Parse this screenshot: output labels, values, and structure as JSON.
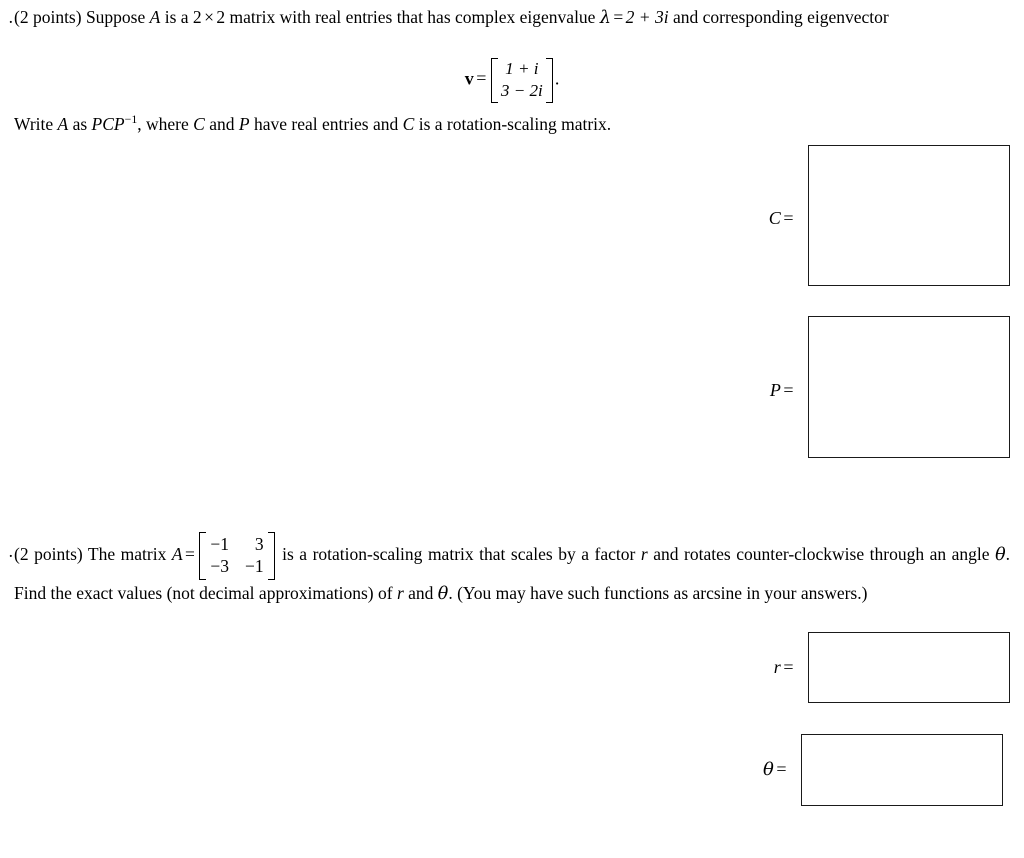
{
  "document": {
    "type": "math-worksheet",
    "page_background": "#ffffff",
    "text_color": "#000000"
  },
  "problems": [
    {
      "marker": ".",
      "points_label": "(2 points)",
      "paragraph_1_pre": "(2 points) Suppose ",
      "var_A": "A",
      "paragraph_1_mid": " is a ",
      "dim_2a": "2",
      "times": "×",
      "dim_2b": "2",
      "paragraph_1_mid2": " matrix with real entries that has complex eigenvalue ",
      "lambda": "λ",
      "equals": "=",
      "eigenvalue": "2 + 3i",
      "paragraph_1_end": " and corresponding eigenvector",
      "vector": {
        "name": "v",
        "equals": "=",
        "entries": [
          "1 + i",
          "3 − 2i"
        ],
        "trailing_punctuation": "."
      },
      "paragraph_2_pre": "Write ",
      "paragraph_2_A": "A",
      "paragraph_2_as": " as ",
      "factorization_base": "PCP",
      "factorization_exp": "−1",
      "paragraph_2_mid": ", where ",
      "paragraph_2_C": "C",
      "paragraph_2_and": " and ",
      "paragraph_2_P": "P",
      "paragraph_2_mid2": " have real entries and ",
      "paragraph_2_C2": "C",
      "paragraph_2_end": " is a rotation-scaling matrix.",
      "answers": [
        {
          "label_var": "C",
          "label_eq": "=",
          "value": ""
        },
        {
          "label_var": "P",
          "label_eq": "=",
          "value": ""
        }
      ]
    },
    {
      "marker": ".",
      "points_label": "(2 points)",
      "paragraph_1_pre": "(2 points) The matrix ",
      "var_A": "A",
      "equals": "=",
      "matrix": {
        "rows": [
          [
            "−1",
            "3"
          ],
          [
            "−3",
            "−1"
          ]
        ]
      },
      "paragraph_1_post": " is a rotation-scaling matrix that scales by a factor ",
      "var_r": "r",
      "paragraph_1_post2": " and rotates counter-clockwise through an angle ",
      "var_theta": "θ",
      "paragraph_1_post3": ". Find the exact values (not decimal approximations) of ",
      "var_r2": "r",
      "paragraph_1_and": " and ",
      "var_theta2": "θ",
      "paragraph_1_post4": ". (You may have such functions as arcsine in your answers.)",
      "answers": [
        {
          "label_var": "r",
          "label_eq": "=",
          "value": ""
        },
        {
          "label_var": "θ",
          "label_eq": "=",
          "value": ""
        }
      ]
    }
  ]
}
